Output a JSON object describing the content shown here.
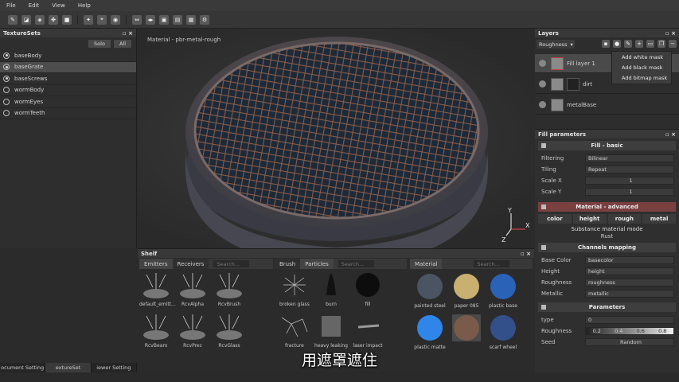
{
  "menu": [
    "File",
    "Edit",
    "View",
    "Help"
  ],
  "texture_sets": {
    "title": "TextureSets",
    "solo_label": "Solo",
    "all_label": "All",
    "items": [
      {
        "label": "baseBody",
        "selected": false
      },
      {
        "label": "baseGrate",
        "selected": true
      },
      {
        "label": "baseScrews",
        "selected": false
      },
      {
        "label": "wormBody",
        "selected": false
      },
      {
        "label": "wormEyes",
        "selected": false
      },
      {
        "label": "wormTeeth",
        "selected": false
      }
    ]
  },
  "viewport": {
    "label": "Material - pbr-metal-rough"
  },
  "axis": {
    "y": "Y",
    "x": "X",
    "z": "Z"
  },
  "layers": {
    "title": "Layers",
    "channel": "Roughness",
    "items": [
      "Fill layer 1",
      "dirt",
      "metalBase"
    ],
    "context_menu": [
      "Add white mask",
      "Add black mask",
      "Add bitmap mask"
    ]
  },
  "fill_params": {
    "title": "Fill parameters",
    "fill_basic": "Fill - basic",
    "filtering_label": "Filtering",
    "filtering_value": "Bilinear",
    "tiling_label": "Tiling",
    "tiling_value": "Repeat",
    "scalex_label": "Scale X",
    "scalex_value": "1",
    "scaley_label": "Scale Y",
    "scaley_value": "1",
    "material_adv": "Material - advanced",
    "chips": [
      "color",
      "height",
      "rough",
      "metal"
    ],
    "substance_mode": "Substance material mode",
    "substance_value": "Rust",
    "channels_mapping": "Channels mapping",
    "map_rows": [
      {
        "label": "Base Color",
        "value": "basecolor"
      },
      {
        "label": "Height",
        "value": "height"
      },
      {
        "label": "Roughness",
        "value": "roughness"
      },
      {
        "label": "Metallic",
        "value": "metallic"
      }
    ],
    "parameters": "Parameters",
    "type_label": "type",
    "type_value": "0",
    "rough_label": "Roughness",
    "rough_ticks": [
      "0.2",
      "0.4",
      "0.6",
      "0.8"
    ],
    "seed_label": "Seed",
    "seed_value": "Random"
  },
  "shelf": {
    "title": "Shelf",
    "tabs1": [
      "Emitters",
      "Receivers"
    ],
    "tabs2": [
      "Brush",
      "Particles"
    ],
    "tabs3": [
      "Material"
    ],
    "search": "Search...",
    "emitters": [
      "default_emitt...",
      "RcvAlpha",
      "RcvBrush",
      "RcvBeam",
      "RcvPrec",
      "RcvGlass"
    ],
    "particles": [
      "broken glass",
      "burn",
      "fill",
      "fracture",
      "heavy leaking",
      "laser impact"
    ],
    "materials": [
      "painted steel",
      "paper 085",
      "plastic base",
      "plastic matte",
      "",
      "scarf wheel"
    ]
  },
  "bottom_tabs": [
    "ocument Setting",
    "extureSet",
    "iewer Setting"
  ],
  "subtitle": "用遮罩遮住"
}
